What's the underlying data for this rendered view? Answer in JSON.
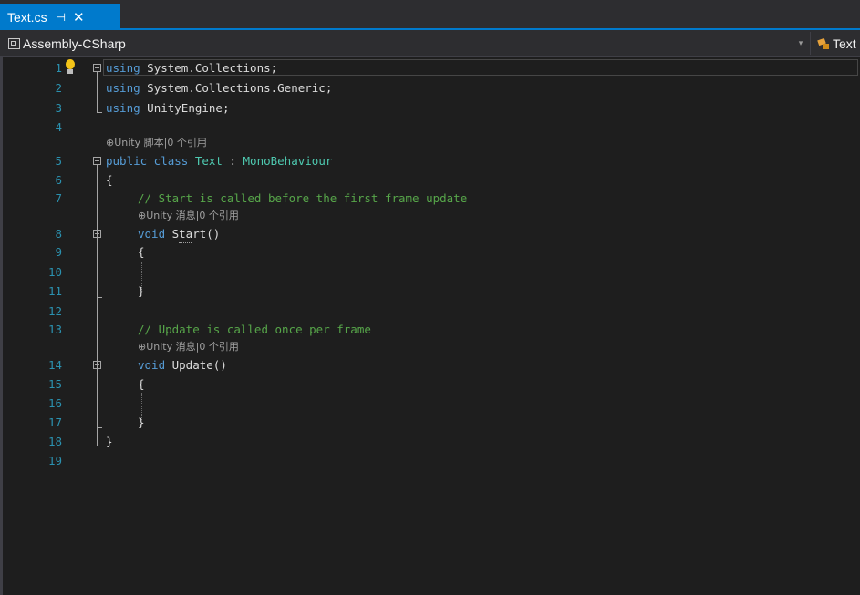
{
  "tab": {
    "title": "Text.cs",
    "pin_glyph": "⊣",
    "close_glyph": "✕"
  },
  "navbar": {
    "project": "Assembly-CSharp",
    "member": "Text",
    "dropdown_glyph": "▾"
  },
  "editor": {
    "line_numbers": [
      "1",
      "2",
      "3",
      "4",
      "5",
      "6",
      "7",
      "8",
      "9",
      "10",
      "11",
      "12",
      "13",
      "14",
      "15",
      "16",
      "17",
      "18",
      "19"
    ],
    "lines": {
      "l1_kw": "using",
      "l1_rest": " System.Collections;",
      "l2_kw": "using",
      "l2_rest": " System.Collections.Generic;",
      "l3_kw": "using",
      "l3_rest": " UnityEngine;",
      "l5_kw1": "public",
      "l5_kw2": " class",
      "l5_name": " Text",
      "l5_colon": " : ",
      "l5_base": "MonoBehaviour",
      "l6": "{",
      "l7": "// Start is called before the first frame update",
      "l8_kw": "void",
      "l8_rest": " Start()",
      "l9": "{",
      "l11": "}",
      "l13": "// Update is called once per frame",
      "l14_kw": "void",
      "l14_rest": " Update()",
      "l15": "{",
      "l17": "}",
      "l18": "}"
    },
    "codelens": {
      "class_lens": "⊕Unity 脚本|0 个引用",
      "start_lens": "⊕Unity 消息|0 个引用",
      "update_lens": "⊕Unity 消息|0 个引用"
    }
  },
  "colors": {
    "accent": "#007acc",
    "keyword": "#569cd6",
    "type": "#4ec9b0",
    "comment": "#57a64a",
    "line_number": "#2b91af",
    "background": "#1e1e1e"
  },
  "icons": {
    "project": "csharp-project-icon",
    "member": "class-icon",
    "lightbulb": "lightbulb-icon"
  }
}
